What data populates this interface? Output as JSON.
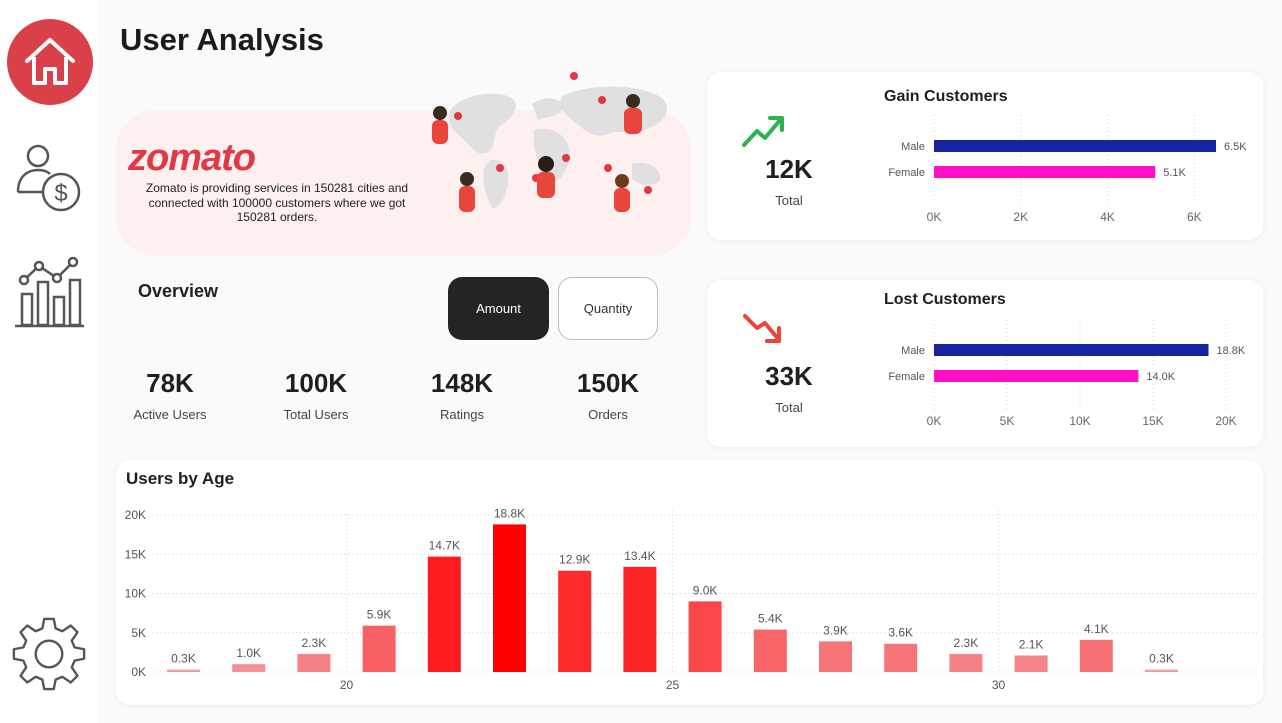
{
  "page": {
    "title": "User Analysis"
  },
  "sidebar": {
    "items": [
      {
        "name": "home",
        "icon": "home-icon",
        "active": true
      },
      {
        "name": "customer-money",
        "icon": "user-dollar-icon"
      },
      {
        "name": "analytics",
        "icon": "bar-line-chart-icon"
      },
      {
        "name": "settings",
        "icon": "gear-icon"
      }
    ],
    "active_color": "#d9404a"
  },
  "banner": {
    "logo": "zomato",
    "text": "Zomato is providing services in 150281 cities and connected with 100000 customers where we got 150281 orders."
  },
  "overview": {
    "title": "Overview",
    "buttons": {
      "amount": "Amount",
      "quantity": "Quantity"
    },
    "kpis": [
      {
        "value": "78K",
        "label": "Active Users"
      },
      {
        "value": "100K",
        "label": "Total Users"
      },
      {
        "value": "148K",
        "label": "Ratings"
      },
      {
        "value": "150K",
        "label": "Orders"
      }
    ]
  },
  "gain": {
    "title": "Gain Customers",
    "total_value": "12K",
    "total_label": "Total",
    "trend_icon": "trend-up-icon",
    "trend_color": "#2db34a"
  },
  "lost": {
    "title": "Lost Customers",
    "total_value": "33K",
    "total_label": "Total",
    "trend_icon": "trend-down-icon",
    "trend_color": "#e8453c"
  },
  "age": {
    "title": "Users by Age"
  },
  "colors": {
    "male": "#1725a0",
    "female": "#ff10c8",
    "accent": "#e23744"
  },
  "chart_data": [
    {
      "type": "bar",
      "orientation": "horizontal",
      "title": "Gain Customers",
      "categories": [
        "Male",
        "Female"
      ],
      "values": [
        6500,
        5100
      ],
      "data_labels": [
        "6.5K",
        "5.1K"
      ],
      "xlim": [
        0,
        6500
      ],
      "xticks": [
        "0K",
        "2K",
        "4K",
        "6K"
      ],
      "xtick_values": [
        0,
        2000,
        4000,
        6000
      ],
      "colors": [
        "#1725a0",
        "#ff10c8"
      ],
      "grid": true
    },
    {
      "type": "bar",
      "orientation": "horizontal",
      "title": "Lost Customers",
      "categories": [
        "Male",
        "Female"
      ],
      "values": [
        18800,
        14000
      ],
      "data_labels": [
        "18.8K",
        "14.0K"
      ],
      "xlim": [
        0,
        20000
      ],
      "xticks": [
        "0K",
        "5K",
        "10K",
        "15K",
        "20K"
      ],
      "xtick_values": [
        0,
        5000,
        10000,
        15000,
        20000
      ],
      "colors": [
        "#1725a0",
        "#ff10c8"
      ],
      "grid": true
    },
    {
      "type": "bar",
      "title": "Users by Age",
      "x": [
        17,
        18,
        19,
        20,
        21,
        22,
        23,
        24,
        25,
        26,
        27,
        28,
        29,
        30,
        31,
        32,
        33
      ],
      "values": [
        300,
        1000,
        2300,
        5900,
        14700,
        18800,
        12900,
        13400,
        9000,
        5400,
        3900,
        3600,
        2300,
        2100,
        4100,
        300
      ],
      "data_labels": [
        "0.3K",
        "1.0K",
        "2.3K",
        "5.9K",
        "14.7K",
        "18.8K",
        "12.9K",
        "13.4K",
        "9.0K",
        "5.4K",
        "3.9K",
        "3.6K",
        "2.3K",
        "2.1K",
        "4.1K",
        "0.3K"
      ],
      "ylim": [
        0,
        20000
      ],
      "yticks": [
        "0K",
        "5K",
        "10K",
        "15K",
        "20K"
      ],
      "ytick_values": [
        0,
        5000,
        10000,
        15000,
        20000
      ],
      "xticks": [
        "20",
        "25",
        "30"
      ],
      "color_low": "#f2a0a6",
      "color_high": "#ff0000",
      "grid": true
    }
  ]
}
